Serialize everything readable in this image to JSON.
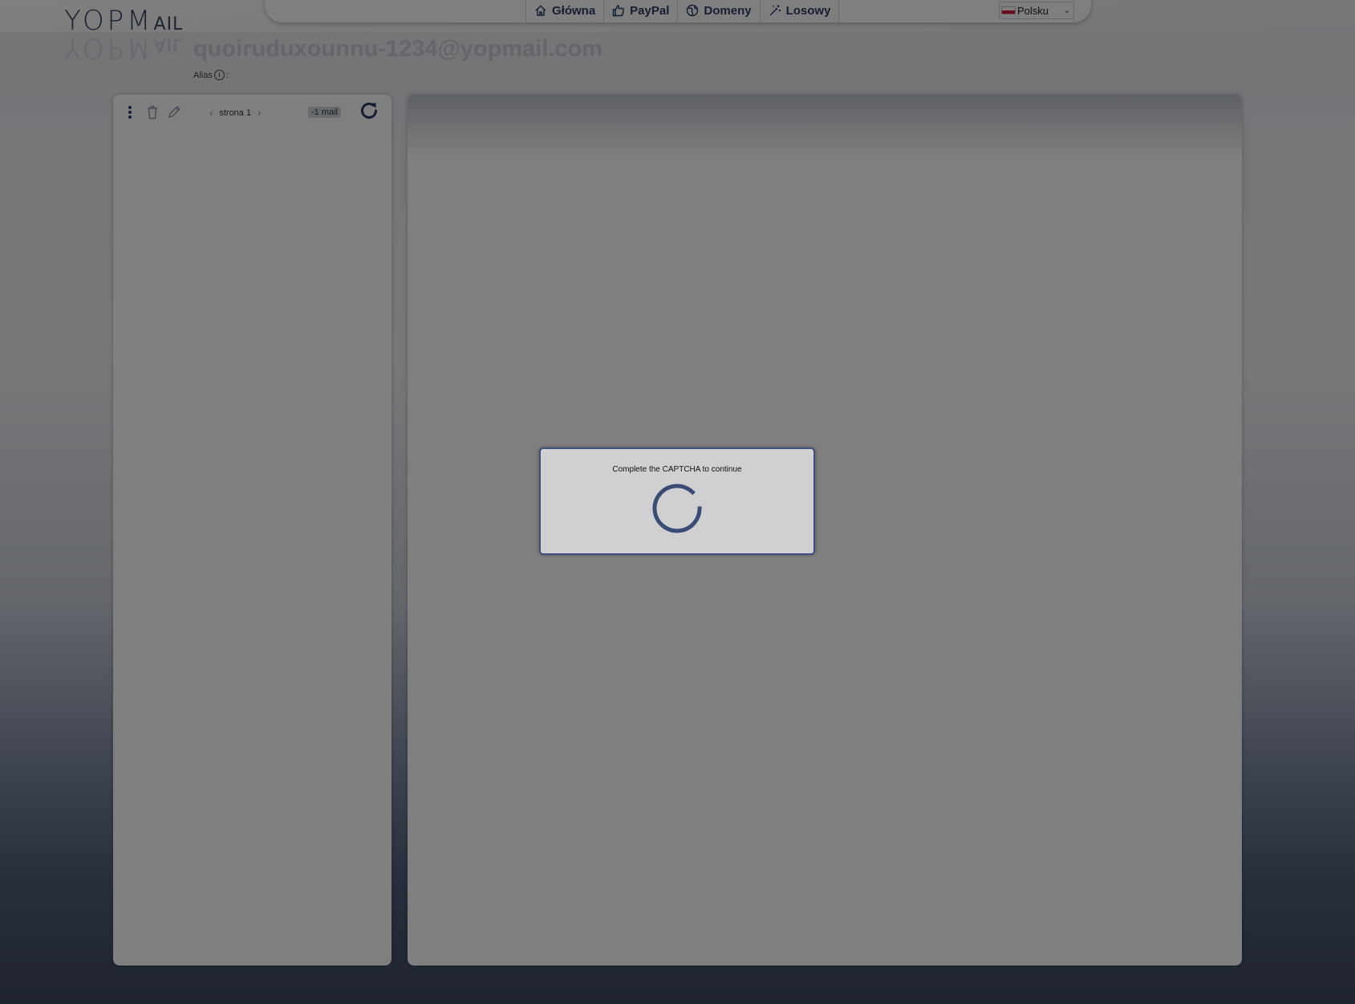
{
  "logo": {
    "text_big": "YOPM",
    "text_small": "AIL"
  },
  "nav": {
    "items": [
      {
        "label": "Główna",
        "icon": "home-icon"
      },
      {
        "label": "PayPal",
        "icon": "thumbs-up-icon"
      },
      {
        "label": "Domeny",
        "icon": "globe-icon"
      },
      {
        "label": "Losowy",
        "icon": "magic-wand-icon"
      }
    ],
    "language": {
      "selected": "Polsku",
      "flag": "poland-flag-icon"
    }
  },
  "header": {
    "email": "quoiruduxounnu-1234@yopmail.com",
    "alias_label": "Alias",
    "alias_suffix": ":"
  },
  "inbox": {
    "toolbar": {
      "menu_icon": "vertical-dots-icon",
      "delete_icon": "trash-icon",
      "compose_icon": "pencil-icon",
      "page_label": "strona 1",
      "prev_icon": "chevron-left-icon",
      "next_icon": "chevron-right-icon",
      "mail_count": "-1 mail",
      "refresh_icon": "refresh-icon"
    }
  },
  "captcha": {
    "message": "Complete the CAPTCHA to continue",
    "spinner_icon": "loading-spinner-icon"
  },
  "colors": {
    "brand": "#2d3e63",
    "overlay": "rgba(0,0,0,0.5)",
    "dialog_border": "#40507a",
    "dialog_bg": "#d0d0d3"
  }
}
